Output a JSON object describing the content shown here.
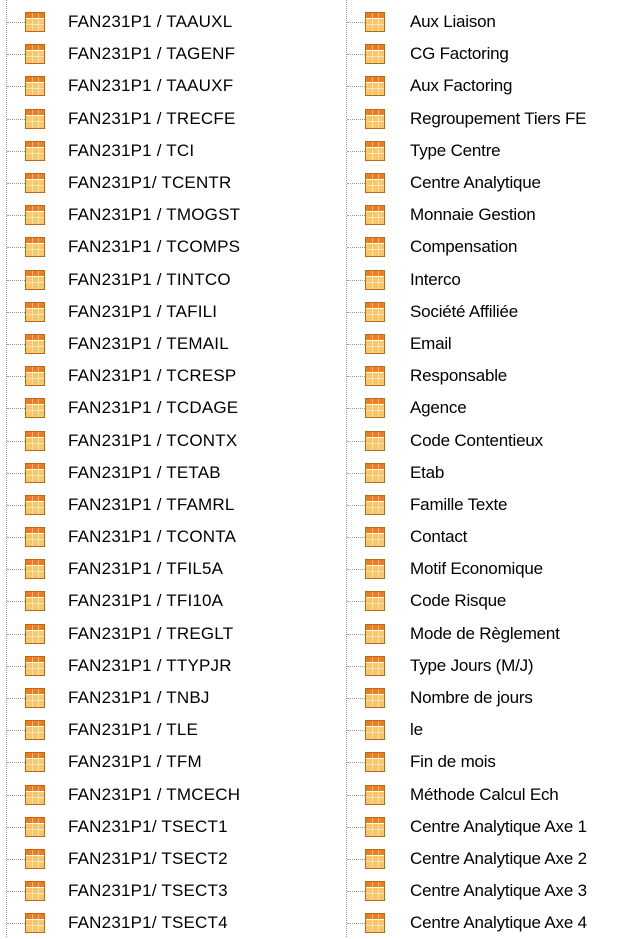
{
  "tables": [
    "FAN231P1 / TAAUXL",
    "FAN231P1 / TAGENF",
    "FAN231P1 / TAAUXF",
    "FAN231P1 / TRECFE",
    "FAN231P1 / TCI",
    "FAN231P1/ TCENTR",
    "FAN231P1 / TMOGST",
    "FAN231P1 / TCOMPS",
    "FAN231P1 / TINTCO",
    "FAN231P1 / TAFILI",
    "FAN231P1 / TEMAIL",
    "FAN231P1 / TCRESP",
    "FAN231P1 / TCDAGE",
    "FAN231P1 / TCONTX",
    "FAN231P1 / TETAB",
    "FAN231P1 / TFAMRL",
    "FAN231P1 / TCONTA",
    "FAN231P1 / TFIL5A",
    "FAN231P1 / TFI10A",
    "FAN231P1 / TREGLT",
    "FAN231P1 / TTYPJR",
    "FAN231P1 / TNBJ",
    "FAN231P1 / TLE",
    "FAN231P1 / TFM",
    "FAN231P1 / TMCECH",
    "FAN231P1/ TSECT1",
    "FAN231P1/ TSECT2",
    "FAN231P1/ TSECT3",
    "FAN231P1/ TSECT4"
  ],
  "labels": [
    "Aux Liaison",
    "CG Factoring",
    "Aux Factoring",
    "Regroupement Tiers FE",
    "Type Centre",
    "Centre Analytique",
    "Monnaie Gestion",
    "Compensation",
    "Interco",
    "Société Affiliée",
    "Email",
    "Responsable",
    "Agence",
    "Code Contentieux",
    "Etab",
    "Famille Texte",
    "Contact",
    "Motif Economique",
    "Code Risque",
    "Mode de Règlement",
    "Type Jours (M/J)",
    "Nombre de jours",
    "le",
    "Fin de mois",
    "Méthode Calcul Ech",
    "Centre Analytique Axe 1",
    "Centre Analytique Axe 2",
    "Centre Analytique Axe 3",
    "Centre Analytique Axe 4"
  ],
  "icon": "table-icon"
}
